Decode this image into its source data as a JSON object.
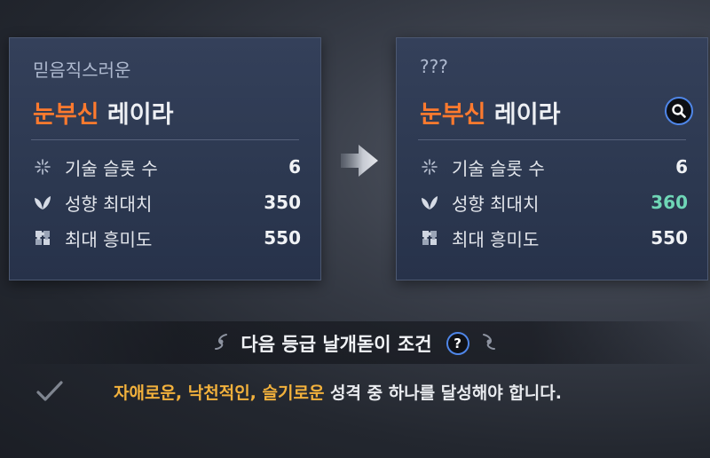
{
  "left_card": {
    "subtitle": "믿음직스러운",
    "name_highlight": "눈부신",
    "name_rest": " 레이라",
    "stats": [
      {
        "label": "기술 슬롯 수",
        "value": "6",
        "icon": "sparkle-icon"
      },
      {
        "label": "성향 최대치",
        "value": "350",
        "icon": "leaf-icon"
      },
      {
        "label": "최대 흥미도",
        "value": "550",
        "icon": "puzzle-icon"
      }
    ]
  },
  "right_card": {
    "subtitle": "???",
    "name_highlight": "눈부신",
    "name_rest": " 레이라",
    "stats": [
      {
        "label": "기술 슬롯 수",
        "value": "6",
        "icon": "sparkle-icon"
      },
      {
        "label": "성향 최대치",
        "value": "360",
        "icon": "leaf-icon",
        "increased": true
      },
      {
        "label": "최대 흥미도",
        "value": "550",
        "icon": "puzzle-icon"
      }
    ],
    "action_icon": "search-icon"
  },
  "upgrade": {
    "title": "다음 등급 날개돋이 조건",
    "help_glyph": "?",
    "condition_highlight": "자애로운, 낙천적인, 슬기로운",
    "condition_rest": " 성격 중 하나를 달성해야 합니다."
  },
  "colors": {
    "name_accent": "#ff7a2e",
    "increased_value": "#6fd6b6",
    "condition_accent": "#f2b13c",
    "button_ring": "#4f86e8"
  }
}
